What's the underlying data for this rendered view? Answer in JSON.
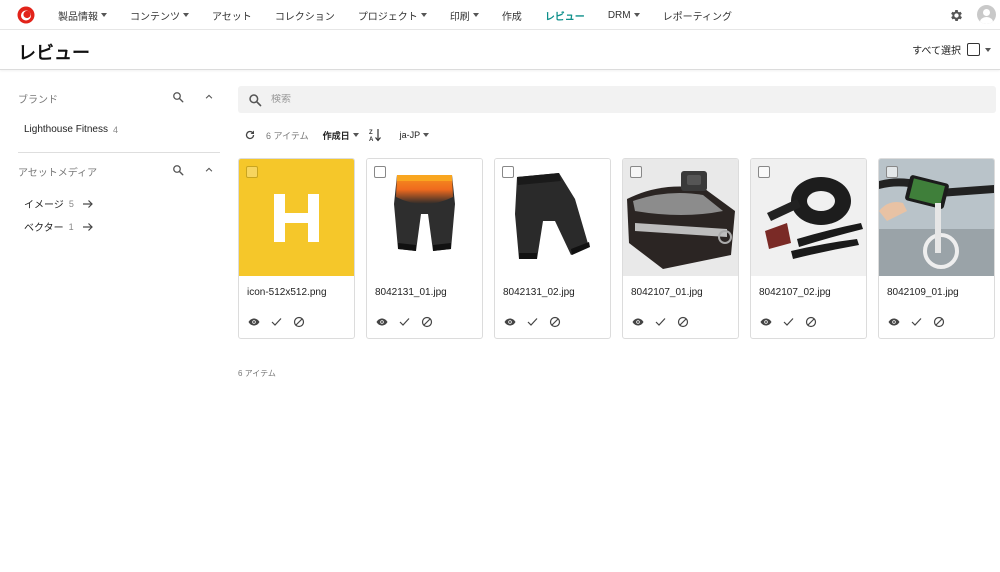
{
  "nav": {
    "items": [
      {
        "label": "製品情報",
        "dropdown": true
      },
      {
        "label": "コンテンツ",
        "dropdown": true
      },
      {
        "label": "アセット",
        "dropdown": false
      },
      {
        "label": "コレクション",
        "dropdown": false
      },
      {
        "label": "プロジェクト",
        "dropdown": true
      },
      {
        "label": "印刷",
        "dropdown": true
      },
      {
        "label": "作成",
        "dropdown": false
      },
      {
        "label": "レビュー",
        "dropdown": false,
        "active": true
      },
      {
        "label": "DRM",
        "dropdown": true
      },
      {
        "label": "レポーティング",
        "dropdown": false
      }
    ],
    "accent_color": "#0d8f8a",
    "logo_color": "#e2231a"
  },
  "header": {
    "title": "レビュー",
    "select_all_label": "すべて選択"
  },
  "sidebar": {
    "brand": {
      "heading": "ブランド",
      "items": [
        {
          "label": "Lighthouse Fitness",
          "count": "4"
        }
      ]
    },
    "media": {
      "heading": "アセットメディア",
      "items": [
        {
          "label": "イメージ",
          "count": "5"
        },
        {
          "label": "ベクター",
          "count": "1"
        }
      ]
    }
  },
  "search": {
    "placeholder": "検索",
    "value": ""
  },
  "toolbar": {
    "count_label": "6 アイテム",
    "sort_label": "作成日",
    "locale": "ja-JP"
  },
  "cards": [
    {
      "filename": "icon-512x512.png",
      "thumb": "h-logo"
    },
    {
      "filename": "8042131_01.jpg",
      "thumb": "shorts-orange"
    },
    {
      "filename": "8042131_02.jpg",
      "thumb": "shorts-black"
    },
    {
      "filename": "8042107_01.jpg",
      "thumb": "saddle-bag"
    },
    {
      "filename": "8042107_02.jpg",
      "thumb": "tire-tools"
    },
    {
      "filename": "8042109_01.jpg",
      "thumb": "phone-mount"
    }
  ],
  "footer": {
    "count_label": "6 アイテム"
  }
}
